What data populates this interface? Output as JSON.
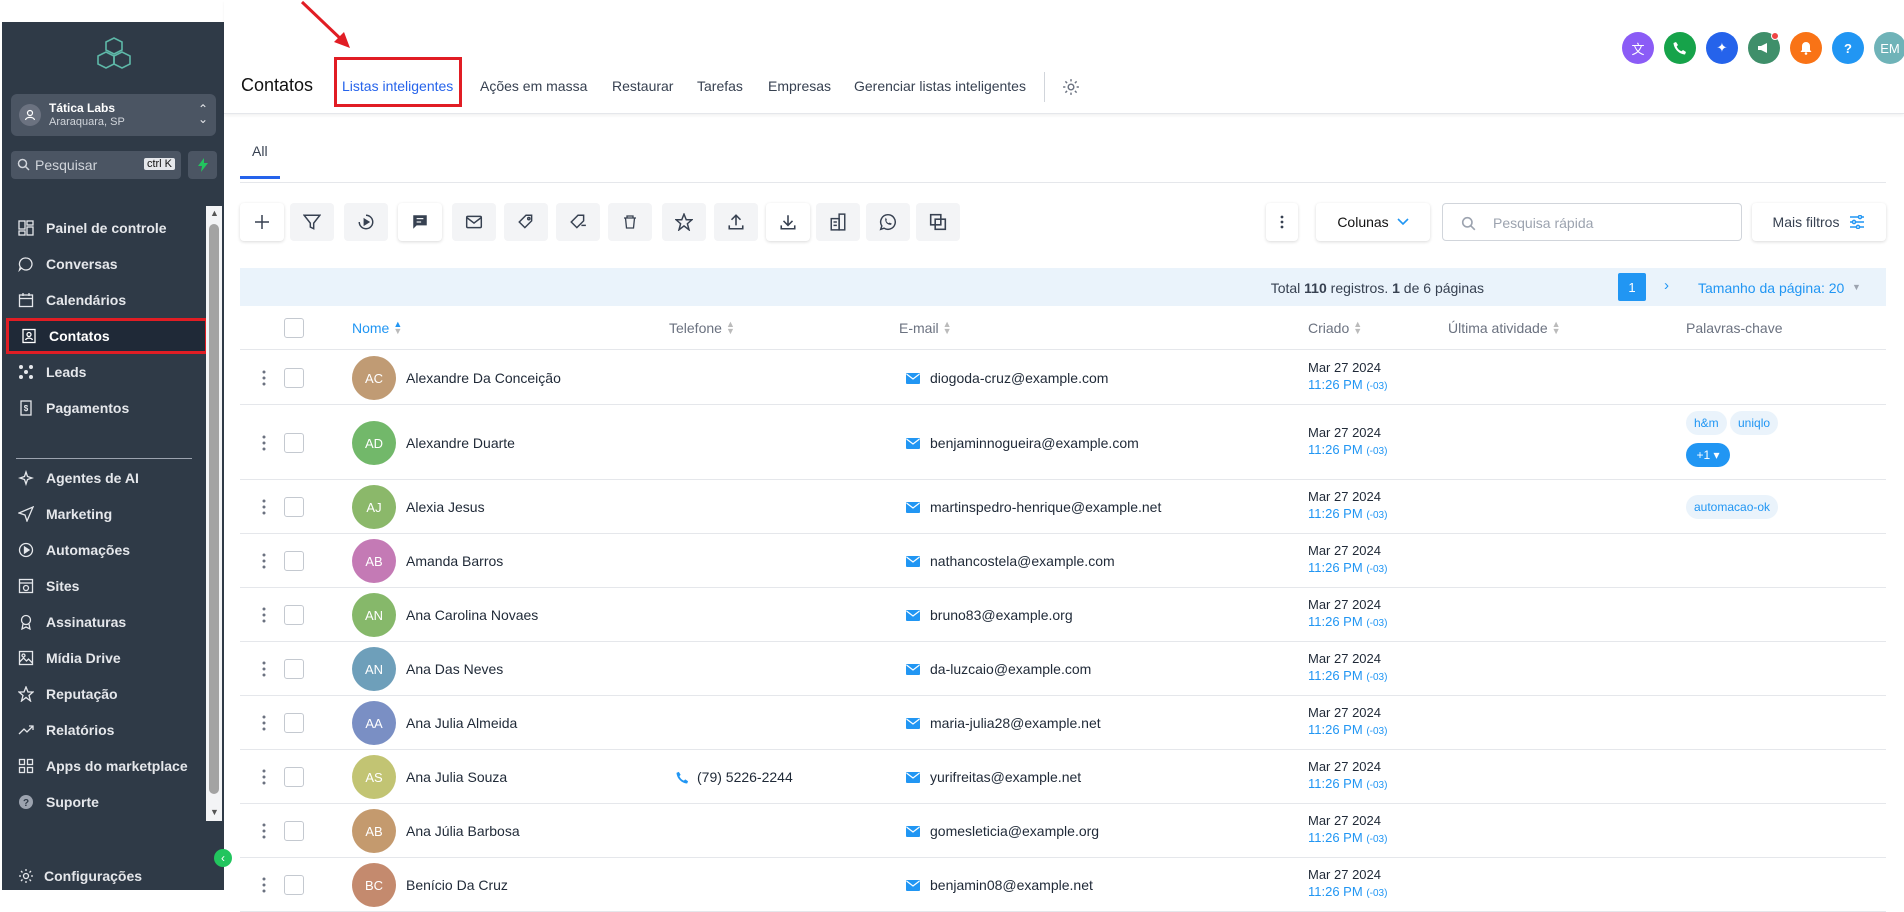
{
  "sidebar": {
    "location_name": "Tática Labs",
    "location_city": "Araraquara, SP",
    "search_placeholder": "Pesquisar",
    "search_shortcut": "ctrl K",
    "items": [
      {
        "label": "Painel de controle",
        "icon": "dashboard-icon"
      },
      {
        "label": "Conversas",
        "icon": "chat-icon"
      },
      {
        "label": "Calendários",
        "icon": "calendar-icon"
      },
      {
        "label": "Contatos",
        "icon": "contacts-icon",
        "active": true
      },
      {
        "label": "Leads",
        "icon": "leads-icon"
      },
      {
        "label": "Pagamentos",
        "icon": "payments-icon"
      },
      {
        "label": "Agentes de AI",
        "icon": "sparkle-icon"
      },
      {
        "label": "Marketing",
        "icon": "send-icon"
      },
      {
        "label": "Automações",
        "icon": "automation-icon"
      },
      {
        "label": "Sites",
        "icon": "sites-icon"
      },
      {
        "label": "Assinaturas",
        "icon": "badge-icon"
      },
      {
        "label": "Mídia Drive",
        "icon": "image-icon"
      },
      {
        "label": "Reputação",
        "icon": "star-icon"
      },
      {
        "label": "Relatórios",
        "icon": "trend-icon"
      },
      {
        "label": "Apps do marketplace",
        "icon": "apps-icon"
      },
      {
        "label": "Suporte",
        "icon": "help-icon"
      }
    ],
    "settings_label": "Configurações"
  },
  "header": {
    "title": "Contatos",
    "tabs": [
      {
        "label": "Listas inteligentes",
        "selected": true
      },
      {
        "label": "Ações em massa"
      },
      {
        "label": "Restaurar"
      },
      {
        "label": "Tarefas"
      },
      {
        "label": "Empresas"
      },
      {
        "label": "Gerenciar listas inteligentes"
      }
    ],
    "top_icons": [
      {
        "name": "translate-icon",
        "color": "#8b5cf6",
        "text": "文A"
      },
      {
        "name": "phone-icon",
        "color": "#16a34a",
        "text": "✆"
      },
      {
        "name": "magic-icon",
        "color": "#2563eb",
        "text": "✦"
      },
      {
        "name": "megaphone-icon",
        "color": "#3f8f6a",
        "text": "📢",
        "dot": true
      },
      {
        "name": "bell-icon",
        "color": "#f97316",
        "text": "🔔"
      },
      {
        "name": "help-icon",
        "color": "#2196f3",
        "text": "?"
      },
      {
        "name": "avatar",
        "color": "#6fb3b8",
        "text": "EM"
      }
    ]
  },
  "view_tab": "All",
  "toolbar": {
    "columns_label": "Colunas",
    "quick_search_placeholder": "Pesquisa rápida",
    "more_filters_label": "Mais filtros"
  },
  "pagination": {
    "total_prefix": "Total ",
    "total_count": "110",
    "total_middle": " registros. ",
    "page_current": "1",
    "page_suffix": " de 6 páginas",
    "page_number": "1",
    "page_size_label": "Tamanho da página: 20"
  },
  "table": {
    "columns": [
      "Nome",
      "Telefone",
      "E-mail",
      "Criado",
      "Última atividade",
      "Palavras-chave"
    ],
    "rows": [
      {
        "initials": "AC",
        "color": "#c09b74",
        "name": "Alexandre Da Conceição",
        "phone": "",
        "email": "diogoda-cruz@example.com",
        "date": "Mar 27 2024",
        "time": "11:26 PM",
        "tz": "(-03)",
        "tags": []
      },
      {
        "initials": "AD",
        "color": "#72b86a",
        "name": "Alexandre Duarte",
        "phone": "",
        "email": "benjaminnogueira@example.com",
        "date": "Mar 27 2024",
        "time": "11:26 PM",
        "tz": "(-03)",
        "tags": [
          "h&m",
          "uniqlo"
        ],
        "more": "+1 ▾"
      },
      {
        "initials": "AJ",
        "color": "#8bb86a",
        "name": "Alexia Jesus",
        "phone": "",
        "email": "martinspedro-henrique@example.net",
        "date": "Mar 27 2024",
        "time": "11:26 PM",
        "tz": "(-03)",
        "tags": [
          "automacao-ok"
        ]
      },
      {
        "initials": "AB",
        "color": "#c47ab5",
        "name": "Amanda Barros",
        "phone": "",
        "email": "nathancostela@example.com",
        "date": "Mar 27 2024",
        "time": "11:26 PM",
        "tz": "(-03)",
        "tags": []
      },
      {
        "initials": "AN",
        "color": "#86b86a",
        "name": "Ana Carolina Novaes",
        "phone": "",
        "email": "bruno83@example.org",
        "date": "Mar 27 2024",
        "time": "11:26 PM",
        "tz": "(-03)",
        "tags": []
      },
      {
        "initials": "AN",
        "color": "#6e9fba",
        "name": "Ana Das Neves",
        "phone": "",
        "email": "da-luzcaio@example.com",
        "date": "Mar 27 2024",
        "time": "11:26 PM",
        "tz": "(-03)",
        "tags": []
      },
      {
        "initials": "AA",
        "color": "#7a8fc4",
        "name": "Ana Julia Almeida",
        "phone": "",
        "email": "maria-julia28@example.net",
        "date": "Mar 27 2024",
        "time": "11:26 PM",
        "tz": "(-03)",
        "tags": []
      },
      {
        "initials": "AS",
        "color": "#c2c473",
        "name": "Ana Julia Souza",
        "phone": "(79) 5226-2244",
        "email": "yurifreitas@example.net",
        "date": "Mar 27 2024",
        "time": "11:26 PM",
        "tz": "(-03)",
        "tags": []
      },
      {
        "initials": "AB",
        "color": "#c49a6e",
        "name": "Ana Júlia Barbosa",
        "phone": "",
        "email": "gomesleticia@example.org",
        "date": "Mar 27 2024",
        "time": "11:26 PM",
        "tz": "(-03)",
        "tags": []
      },
      {
        "initials": "BC",
        "color": "#c48a6e",
        "name": "Benício Da Cruz",
        "phone": "",
        "email": "benjamin08@example.net",
        "date": "Mar 27 2024",
        "time": "11:26 PM",
        "tz": "(-03)",
        "tags": []
      }
    ]
  }
}
